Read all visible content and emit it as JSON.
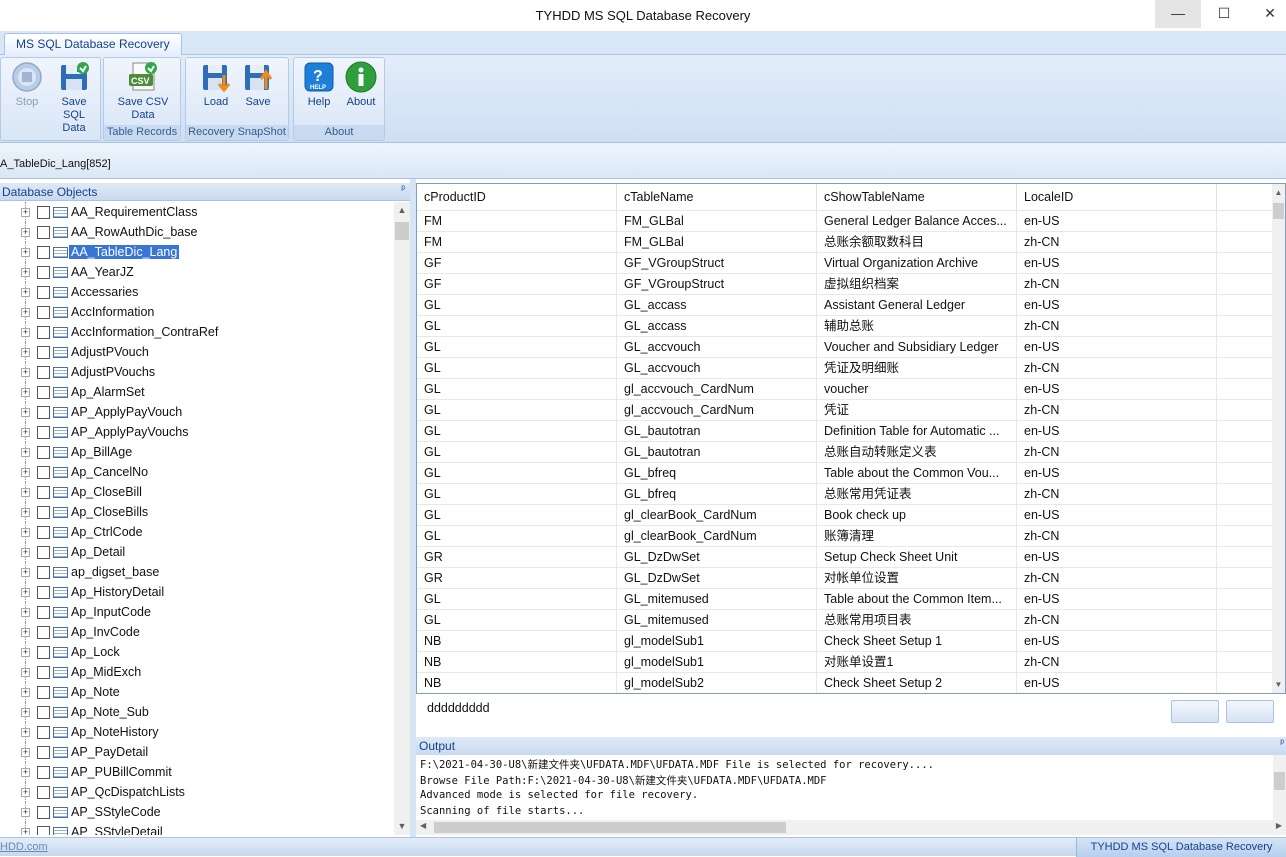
{
  "window": {
    "title": "TYHDD MS SQL Database Recovery",
    "controls": [
      "—",
      "☐",
      "✕"
    ]
  },
  "ribbon": {
    "tab": "MS SQL Database Recovery",
    "groups": {
      "table_records": {
        "label": "Table Records",
        "stop": "Stop",
        "save_sql": [
          "Save SQL",
          "Data"
        ],
        "save_csv": [
          "Save CSV",
          "Data"
        ]
      },
      "snapshot": {
        "label": "Recovery SnapShot",
        "load": "Load",
        "save": "Save"
      },
      "about": {
        "label": "About",
        "help": "Help",
        "about": "About"
      }
    },
    "icons": {
      "stop": "stop-icon",
      "save_sql": "save-sql-icon",
      "save_csv": "save-csv-icon",
      "load": "load-snapshot-icon",
      "save": "save-snapshot-icon",
      "help": "help-icon",
      "about": "info-icon"
    }
  },
  "address": "A_TableDic_Lang[852]",
  "left_panel": {
    "title": "Database Objects",
    "pin": "ᵖ",
    "selected": "AA_TableDic_Lang",
    "items": [
      "AA_RequirementClass",
      "AA_RowAuthDic_base",
      "AA_TableDic_Lang",
      "AA_YearJZ",
      "Accessaries",
      "AccInformation",
      "AccInformation_ContraRef",
      "AdjustPVouch",
      "AdjustPVouchs",
      "Ap_AlarmSet",
      "AP_ApplyPayVouch",
      "AP_ApplyPayVouchs",
      "Ap_BillAge",
      "Ap_CancelNo",
      "Ap_CloseBill",
      "Ap_CloseBills",
      "Ap_CtrlCode",
      "Ap_Detail",
      "ap_digset_base",
      "Ap_HistoryDetail",
      "Ap_InputCode",
      "Ap_InvCode",
      "Ap_Lock",
      "Ap_MidExch",
      "Ap_Note",
      "Ap_Note_Sub",
      "Ap_NoteHistory",
      "AP_PayDetail",
      "AP_PUBillCommit",
      "AP_QcDispatchLists",
      "AP_SStyleCode",
      "AP_SStyleDetail"
    ]
  },
  "grid": {
    "columns": [
      "cProductID",
      "cTableName",
      "cShowTableName",
      "LocaleID"
    ],
    "rows": [
      [
        "FM",
        "FM_GLBal",
        "General Ledger Balance Acces...",
        "en-US"
      ],
      [
        "FM",
        "FM_GLBal",
        "总账余额取数科目",
        "zh-CN"
      ],
      [
        "GF",
        "GF_VGroupStruct",
        "Virtual Organization Archive",
        "en-US"
      ],
      [
        "GF",
        "GF_VGroupStruct",
        "虚拟组织档案",
        "zh-CN"
      ],
      [
        "GL",
        "GL_accass",
        "Assistant General Ledger",
        "en-US"
      ],
      [
        "GL",
        "GL_accass",
        "辅助总账",
        "zh-CN"
      ],
      [
        "GL",
        "GL_accvouch",
        "Voucher and Subsidiary Ledger",
        "en-US"
      ],
      [
        "GL",
        "GL_accvouch",
        "凭证及明细账",
        "zh-CN"
      ],
      [
        "GL",
        "gl_accvouch_CardNum",
        "voucher",
        "en-US"
      ],
      [
        "GL",
        "gl_accvouch_CardNum",
        "凭证",
        "zh-CN"
      ],
      [
        "GL",
        "GL_bautotran",
        "Definition Table for Automatic ...",
        "en-US"
      ],
      [
        "GL",
        "GL_bautotran",
        "总账自动转账定义表",
        "zh-CN"
      ],
      [
        "GL",
        "GL_bfreq",
        "Table about the Common Vou...",
        "en-US"
      ],
      [
        "GL",
        "GL_bfreq",
        "总账常用凭证表",
        "zh-CN"
      ],
      [
        "GL",
        "gl_clearBook_CardNum",
        "Book check up",
        "en-US"
      ],
      [
        "GL",
        "gl_clearBook_CardNum",
        "账簿清理",
        "zh-CN"
      ],
      [
        "GR",
        "GL_DzDwSet",
        "Setup Check Sheet Unit",
        "en-US"
      ],
      [
        "GR",
        "GL_DzDwSet",
        "对帐单位设置",
        "zh-CN"
      ],
      [
        "GL",
        "GL_mitemused",
        "Table about the Common Item...",
        "en-US"
      ],
      [
        "GL",
        "GL_mitemused",
        "总账常用项目表",
        "zh-CN"
      ],
      [
        "NB",
        "gl_modelSub1",
        "Check Sheet Setup 1",
        "en-US"
      ],
      [
        "NB",
        "gl_modelSub1",
        "对账单设置1",
        "zh-CN"
      ],
      [
        "NB",
        "gl_modelSub2",
        "Check Sheet Setup 2",
        "en-US"
      ]
    ]
  },
  "pager": {
    "text": "ddddddddd",
    "prev_icon": "arrow-left-icon",
    "next_icon": "arrow-right-icon"
  },
  "output": {
    "title": "Output",
    "lines": [
      "F:\\2021-04-30-U8\\新建文件夹\\UFDATA.MDF\\UFDATA.MDF File is selected for recovery....",
      "Browse File Path:F:\\2021-04-30-U8\\新建文件夹\\UFDATA.MDF\\UFDATA.MDF",
      "Advanced mode is selected for file recovery.",
      "Scanning of file starts..."
    ]
  },
  "status": {
    "link": "HDD.com",
    "right": "TYHDD MS SQL Database Recovery"
  }
}
